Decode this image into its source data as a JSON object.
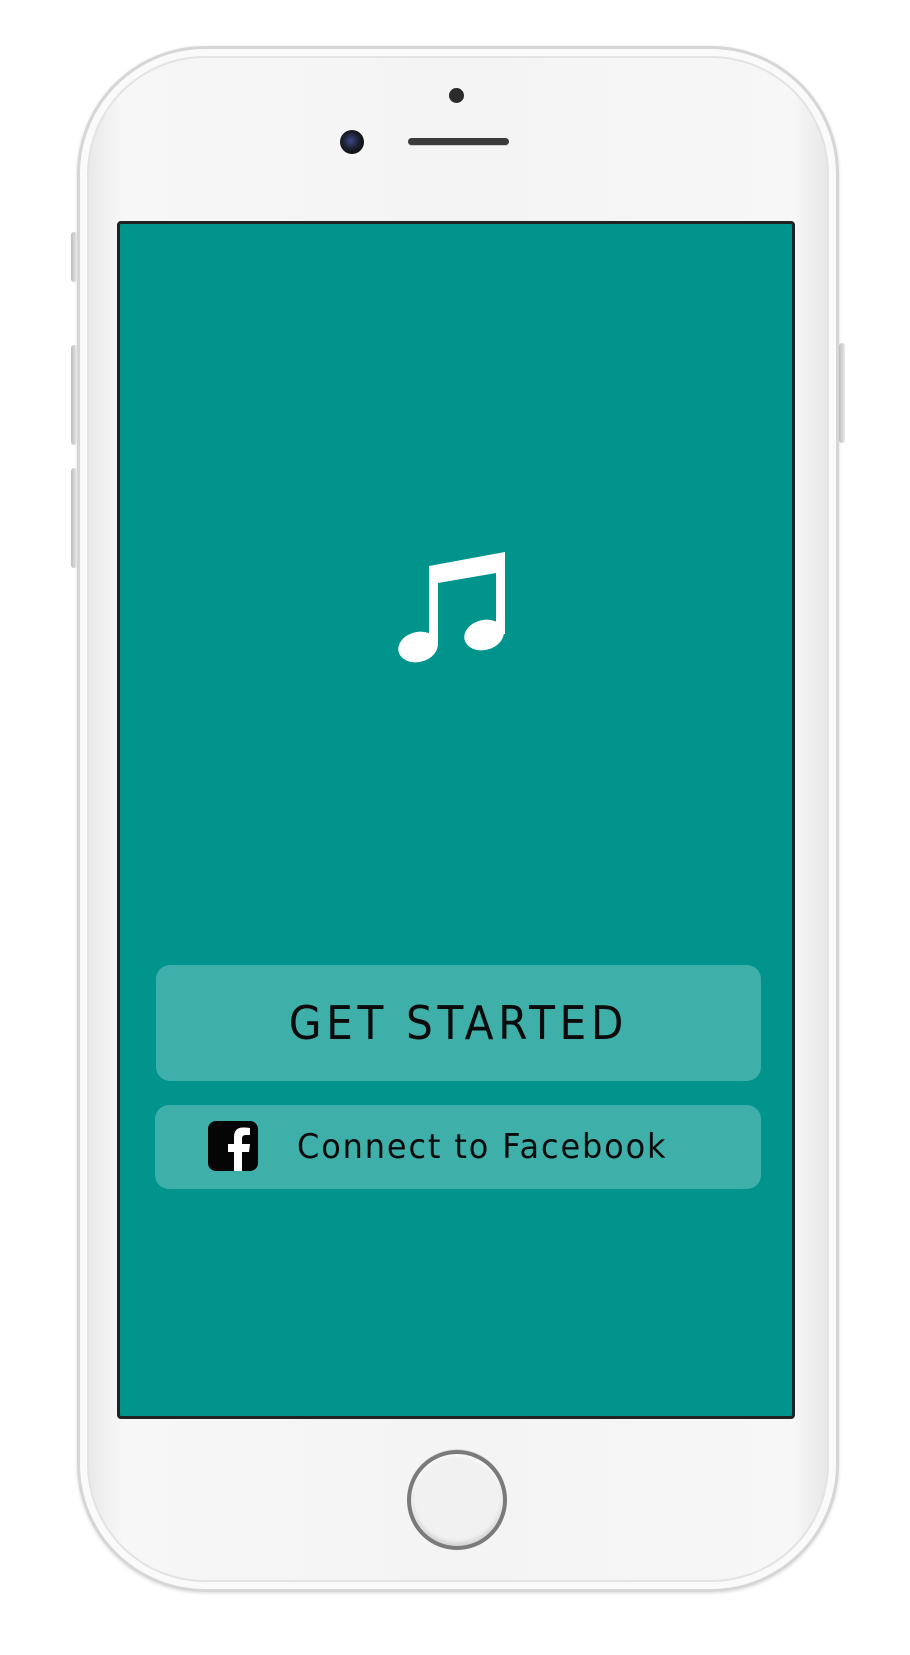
{
  "app": {
    "logo_icon": "music-note-icon",
    "screen_color": "#00948d",
    "button_color": "#3fafa9"
  },
  "actions": {
    "get_started_label": "GET STARTED",
    "facebook_label": "Connect to Facebook",
    "facebook_icon": "facebook-icon"
  },
  "device": {
    "model": "iphone-white",
    "home_button_icon": "home-button"
  }
}
